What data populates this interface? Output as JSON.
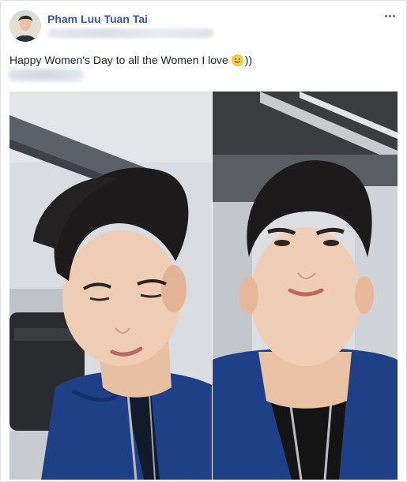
{
  "post": {
    "author_name": "Pham Luu Tuan Tai",
    "message": "Happy Women's Day to all the Women I love",
    "message_suffix": "))",
    "emoji_icon": "smiley-emoji-icon",
    "options_icon": "more-options-icon"
  },
  "photos": [
    {
      "name": "selfie-winking"
    },
    {
      "name": "selfie-low-angle"
    }
  ],
  "colors": {
    "author_link": "#385898",
    "body_text": "#1d2129",
    "card_border": "#dddfe2",
    "jacket": "#1f3f86"
  }
}
